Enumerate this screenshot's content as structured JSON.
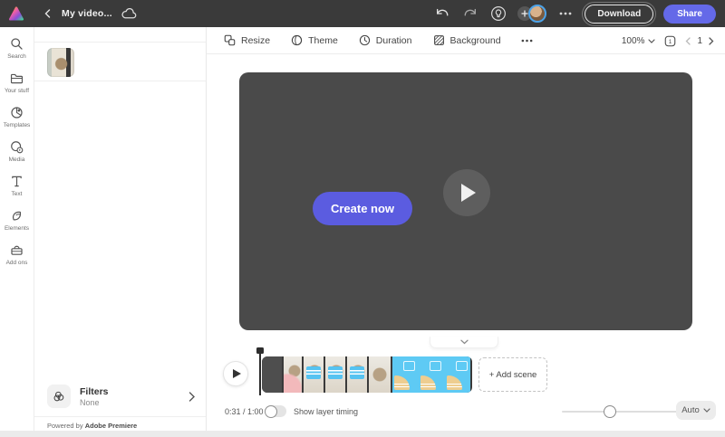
{
  "topbar": {
    "title": "My video...",
    "download_label": "Download",
    "share_label": "Share"
  },
  "rail": {
    "items": [
      {
        "label": "Search"
      },
      {
        "label": "Your stuff"
      },
      {
        "label": "Templates"
      },
      {
        "label": "Media"
      },
      {
        "label": "Text"
      },
      {
        "label": "Elements"
      },
      {
        "label": "Add ons"
      }
    ]
  },
  "panel": {
    "filters_title": "Filters",
    "filters_value": "None",
    "powered_prefix": "Powered by ",
    "powered_brand": "Adobe Premiere"
  },
  "toolbar": {
    "resize_label": "Resize",
    "theme_label": "Theme",
    "duration_label": "Duration",
    "background_label": "Background",
    "zoom_level": "100%",
    "page_icon_number": "1",
    "page_number": "1"
  },
  "canvas": {
    "cta_label": "Create now"
  },
  "timeline": {
    "add_scene_label": "+ Add scene"
  },
  "bottombar": {
    "time": "0:31 / 1:00",
    "toggle_label": "Show layer timing",
    "auto_label": "Auto"
  },
  "colors": {
    "topbar_bg": "#3a3a3a",
    "canvas_bg": "#4a4a4a",
    "accent_purple": "#5b5ce0",
    "share_blue": "#6469e8",
    "timeline_cyan": "#5ecaf4",
    "card_tan": "#eecd90"
  }
}
